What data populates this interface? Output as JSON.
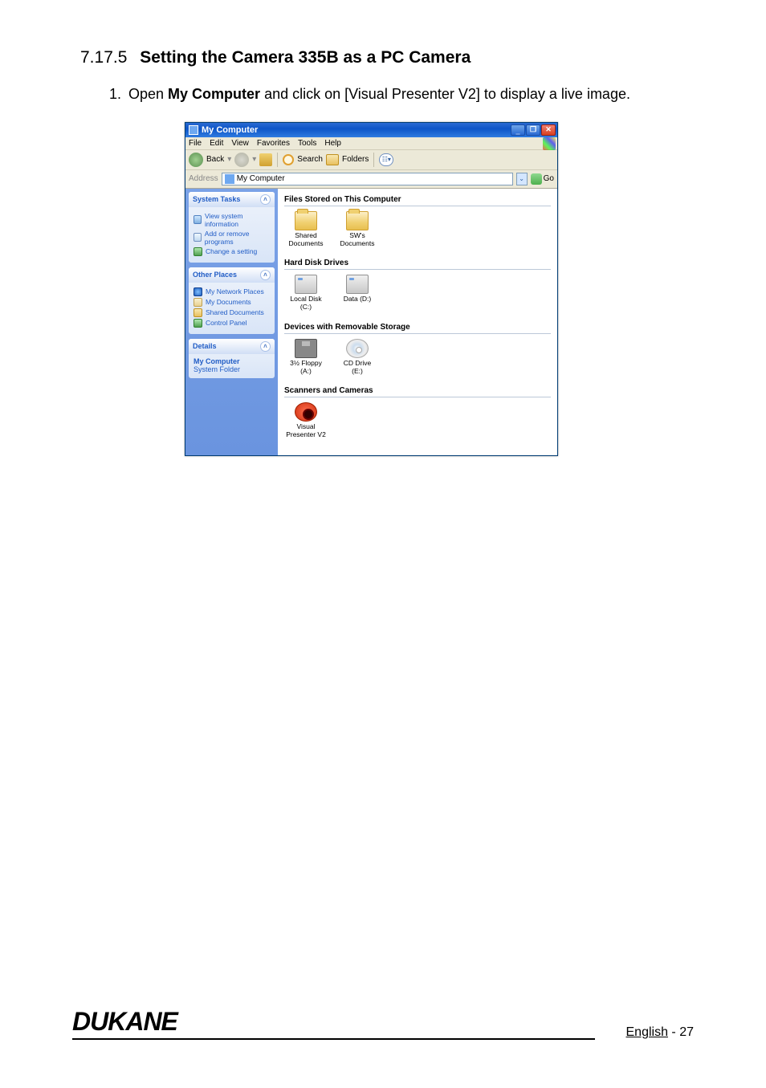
{
  "doc": {
    "section_number": "7.17.5",
    "section_title": "Setting the Camera 335B as a PC Camera",
    "step1_pre": "Open ",
    "step1_bold": "My Computer",
    "step1_post": " and click on [Visual Presenter V2] to display a live image.",
    "brand": "DUKANE",
    "page_label": "English",
    "page_sep": " - ",
    "page_num": "27"
  },
  "win": {
    "title": "My Computer",
    "menu": {
      "file": "File",
      "edit": "Edit",
      "view": "View",
      "favorites": "Favorites",
      "tools": "Tools",
      "help": "Help"
    },
    "toolbar": {
      "back": "Back",
      "search": "Search",
      "folders": "Folders"
    },
    "address": {
      "label": "Address",
      "value": "My Computer",
      "go": "Go"
    },
    "side": {
      "tasks": {
        "title": "System Tasks",
        "i1": "View system information",
        "i2": "Add or remove programs",
        "i3": "Change a setting"
      },
      "places": {
        "title": "Other Places",
        "i1": "My Network Places",
        "i2": "My Documents",
        "i3": "Shared Documents",
        "i4": "Control Panel"
      },
      "details": {
        "title": "Details",
        "name": "My Computer",
        "type": "System Folder"
      }
    },
    "groups": {
      "files": {
        "title": "Files Stored on This Computer",
        "i1": "Shared Documents",
        "i2": "SW's Documents"
      },
      "hdd": {
        "title": "Hard Disk Drives",
        "i1": "Local Disk (C:)",
        "i2": "Data (D:)"
      },
      "removable": {
        "title": "Devices with Removable Storage",
        "i1": "3½ Floppy (A:)",
        "i2": "CD Drive (E:)"
      },
      "scanners": {
        "title": "Scanners and Cameras",
        "i1": "Visual Presenter V2"
      }
    }
  }
}
